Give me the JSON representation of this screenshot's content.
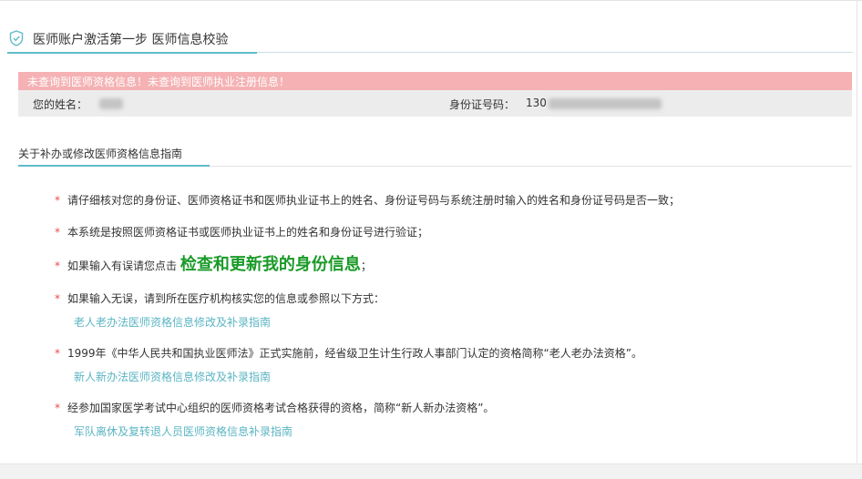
{
  "header": {
    "title": "医师账户激活第一步 医师信息校验",
    "icon": "shield-check-icon",
    "accent_color": "#5fbcc8"
  },
  "alert": {
    "message": "未查询到医师资格信息！未查询到医师执业注册信息！",
    "color": "#f5b1b3"
  },
  "info": {
    "name_label": "您的姓名：",
    "id_label": "身份证号码：",
    "id_prefix": "130"
  },
  "guide": {
    "title": "关于补办或修改医师资格信息指南",
    "star": "*",
    "items": [
      {
        "text": "请仔细核对您的身份证、医师资格证书和医师执业证书上的姓名、身份证号码与系统注册时输入的姓名和身份证号码是否一致；"
      },
      {
        "text": "本系统是按照医师资格证书或医师执业证书上的姓名和身份证号进行验证；"
      },
      {
        "text_before": "如果输入有误请您点击",
        "action": "检查和更新我的身份信息",
        "text_after": "；"
      },
      {
        "text": "如果输入无误，请到所在医疗机构核实您的信息或参照以下方式：",
        "link": "老人老办法医师资格信息修改及补录指南"
      },
      {
        "text": "1999年《中华人民共和国执业医师法》正式实施前，经省级卫生计生行政人事部门认定的资格简称“老人老办法资格”。",
        "link": "新人新办法医师资格信息修改及补录指南"
      },
      {
        "text": "经参加国家医学考试中心组织的医师资格考试合格获得的资格，简称“新人新办法资格”。",
        "link": "军队离休及复转退人员医师资格信息补录指南"
      }
    ]
  }
}
